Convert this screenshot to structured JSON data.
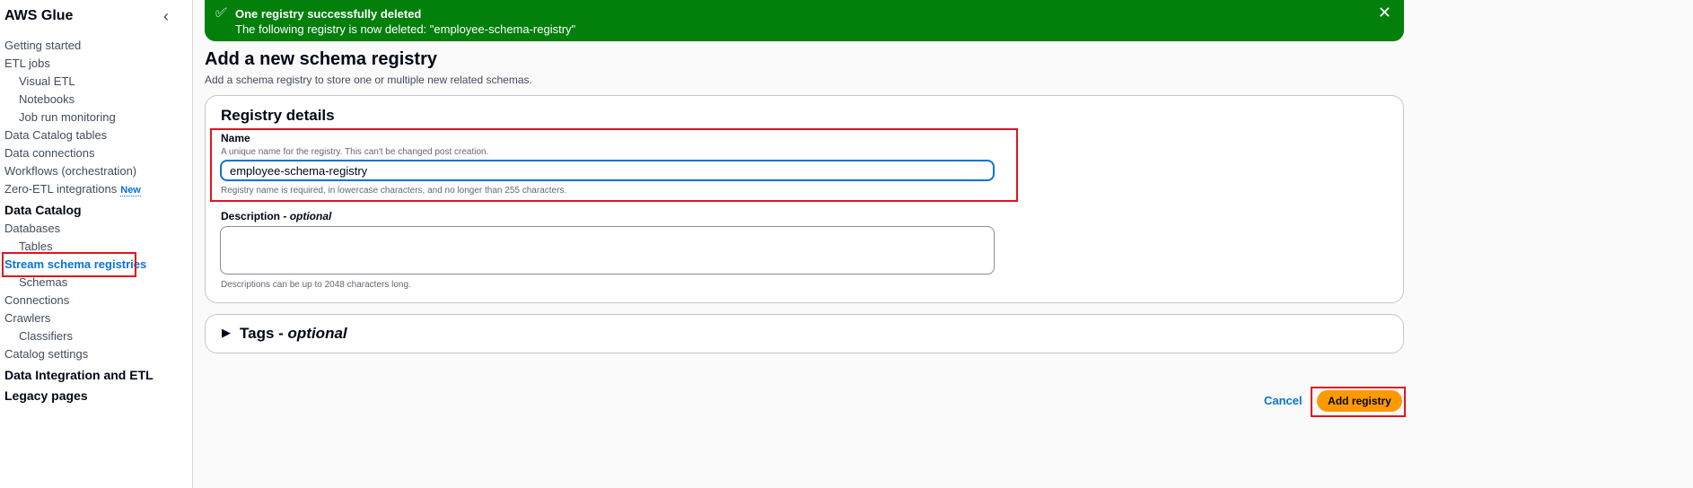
{
  "sidebar": {
    "title": "AWS Glue",
    "items": [
      {
        "label": "Getting started",
        "type": "item"
      },
      {
        "label": "ETL jobs",
        "type": "item"
      },
      {
        "label": "Visual ETL",
        "type": "sub"
      },
      {
        "label": "Notebooks",
        "type": "sub"
      },
      {
        "label": "Job run monitoring",
        "type": "sub"
      },
      {
        "label": "Data Catalog tables",
        "type": "item"
      },
      {
        "label": "Data connections",
        "type": "item"
      },
      {
        "label": "Workflows (orchestration)",
        "type": "item"
      },
      {
        "label": "Zero-ETL integrations",
        "type": "item",
        "badge": "New"
      },
      {
        "label": "Data Catalog",
        "type": "head"
      },
      {
        "label": "Databases",
        "type": "item"
      },
      {
        "label": "Tables",
        "type": "sub"
      },
      {
        "label": "Stream schema registries",
        "type": "active"
      },
      {
        "label": "Schemas",
        "type": "sub"
      },
      {
        "label": "Connections",
        "type": "item"
      },
      {
        "label": "Crawlers",
        "type": "item"
      },
      {
        "label": "Classifiers",
        "type": "sub"
      },
      {
        "label": "Catalog settings",
        "type": "item"
      },
      {
        "label": "Data Integration and ETL",
        "type": "head"
      },
      {
        "label": "Legacy pages",
        "type": "head"
      }
    ]
  },
  "banner": {
    "title": "One registry successfully deleted",
    "message": "The following registry is now deleted: \"employee-schema-registry\"",
    "color": "#037f0c"
  },
  "page": {
    "title": "Add a new schema registry",
    "subtitle": "Add a schema registry to store one or multiple new related schemas."
  },
  "details": {
    "heading": "Registry details",
    "name_label": "Name",
    "name_hint": "A unique name for the registry. This can't be changed post creation.",
    "name_value": "employee-schema-registry",
    "name_help": "Registry name is required, in lowercase characters, and no longer than 255 characters.",
    "desc_label": "Description",
    "desc_optional": "optional",
    "desc_value": "",
    "desc_help": "Descriptions can be up to 2048 characters long."
  },
  "tags": {
    "label": "Tags",
    "optional": "optional"
  },
  "actions": {
    "cancel": "Cancel",
    "submit": "Add registry",
    "submit_color": "#ff9900"
  }
}
